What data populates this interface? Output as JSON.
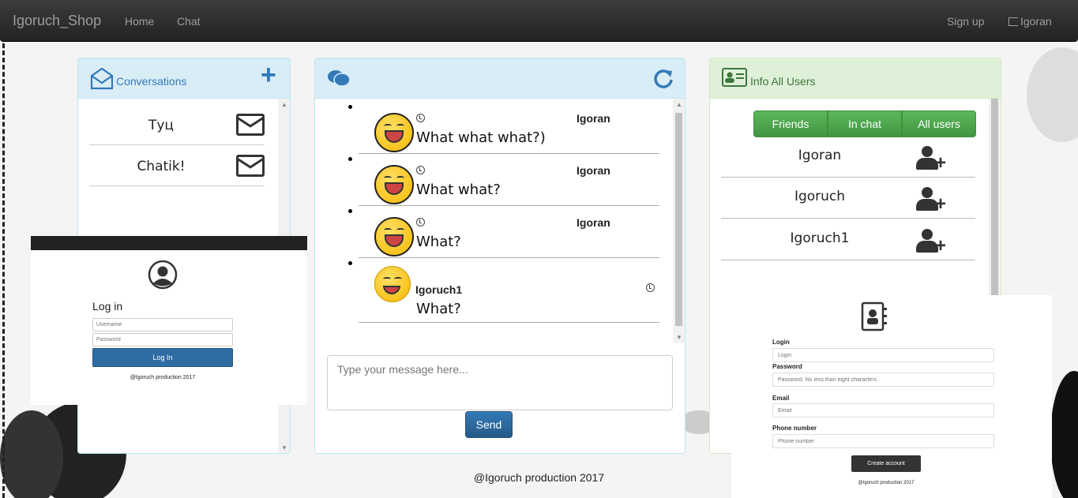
{
  "navbar": {
    "brand": "Igoruch_Shop",
    "home": "Home",
    "chat": "Chat",
    "signup": "Sign up",
    "user": "Igoran"
  },
  "conversations": {
    "title": "Conversations",
    "items": [
      {
        "name": "Туц"
      },
      {
        "name": "Chatik!"
      }
    ]
  },
  "chat": {
    "messages": [
      {
        "author": "Igoran",
        "text": "What what what?)"
      },
      {
        "author": "Igoran",
        "text": "What what?"
      },
      {
        "author": "Igoran",
        "text": "What?"
      },
      {
        "author": "Igoruch1",
        "text": "What?"
      }
    ],
    "input_placeholder": "Type your message here...",
    "send_label": "Send"
  },
  "users": {
    "title": "Info All Users",
    "tabs": [
      "Friends",
      "In chat",
      "All users"
    ],
    "list": [
      {
        "name": "Igoran"
      },
      {
        "name": "Igoruch"
      },
      {
        "name": "Igoruch1"
      }
    ]
  },
  "login_preview": {
    "heading": "Log in",
    "username_placeholder": "Username",
    "password_placeholder": "Password",
    "button": "Log In",
    "footer": "@Igoruch production 2017"
  },
  "register_preview": {
    "login_label": "Login",
    "login_placeholder": "Login",
    "password_label": "Password",
    "password_placeholder": "Password. No less than eight characters",
    "email_label": "Email",
    "email_placeholder": "Email",
    "phone_label": "Phone number",
    "phone_placeholder": "Phone number",
    "button": "Create account",
    "footer": "@Igoruch production 2017"
  },
  "footer": "@Igoruch production 2017",
  "colors": {
    "navbar": "#222222",
    "panel_blue": "#d9edf7",
    "panel_green": "#dff0d8",
    "send": "#337ab7",
    "tab_green": "#5cb85c"
  }
}
